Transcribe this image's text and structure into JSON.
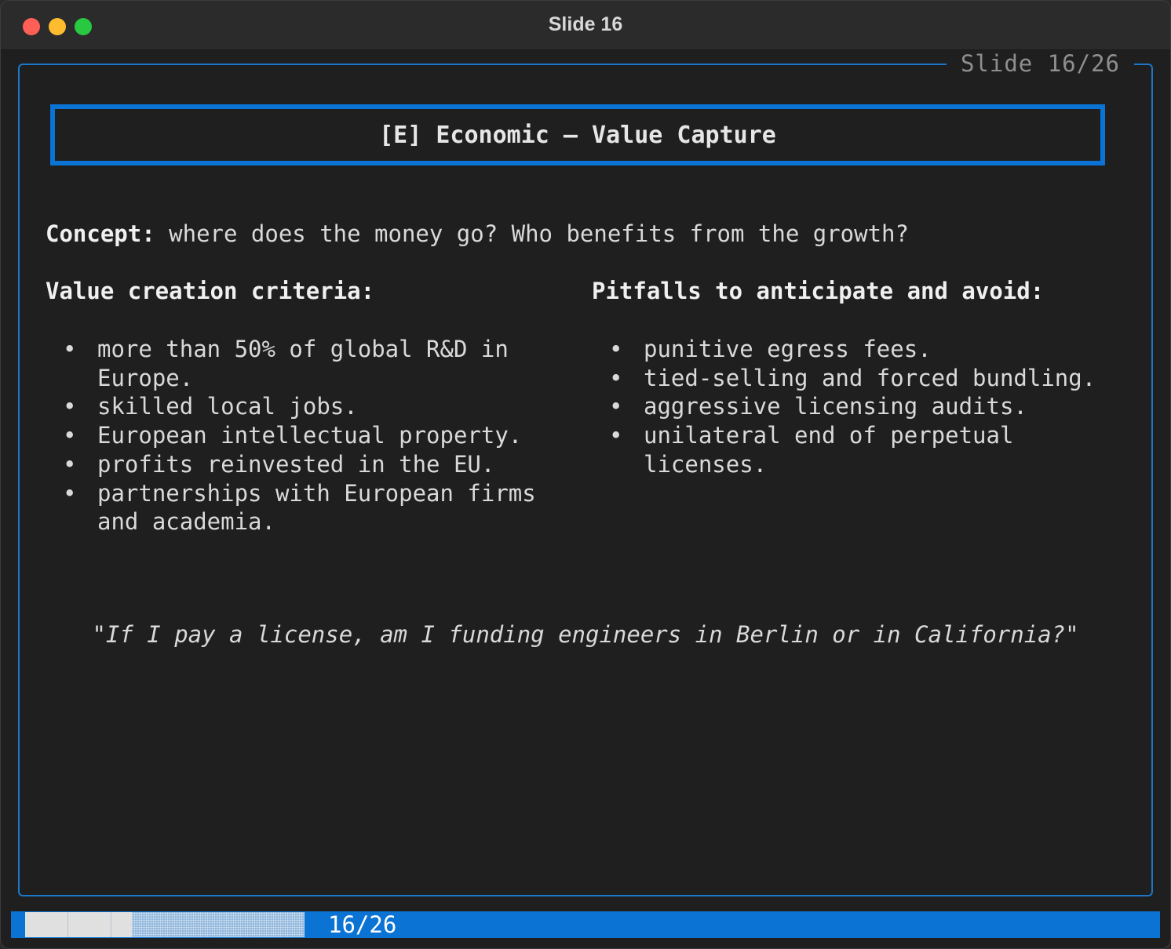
{
  "window": {
    "title": "Slide 16"
  },
  "slide": {
    "frame_label": "Slide 16/26",
    "title": "[E] Economic — Value Capture",
    "concept_label": "Concept:",
    "concept_text": " where does the money go? Who benefits from the growth?",
    "left_heading": "Value creation criteria:",
    "left_bullets": [
      "more than 50% of global R&D in Europe.",
      "skilled local jobs.",
      "European intellectual property.",
      "profits reinvested in the EU.",
      "partnerships with European firms and academia."
    ],
    "right_heading": "Pitfalls to anticipate and avoid:",
    "right_bullets": [
      "punitive egress fees.",
      "tied-selling and forced bundling.",
      "aggressive licensing audits.",
      "unilateral end of perpetual licenses."
    ],
    "quote": "\"If I pay a license, am I funding engineers in Berlin or in California?\""
  },
  "status": {
    "current": 16,
    "total": 26,
    "count_label": "16/26"
  },
  "colors": {
    "accent": "#0a73d4",
    "background": "#1f1f1f",
    "text": "#d9d9d9"
  }
}
